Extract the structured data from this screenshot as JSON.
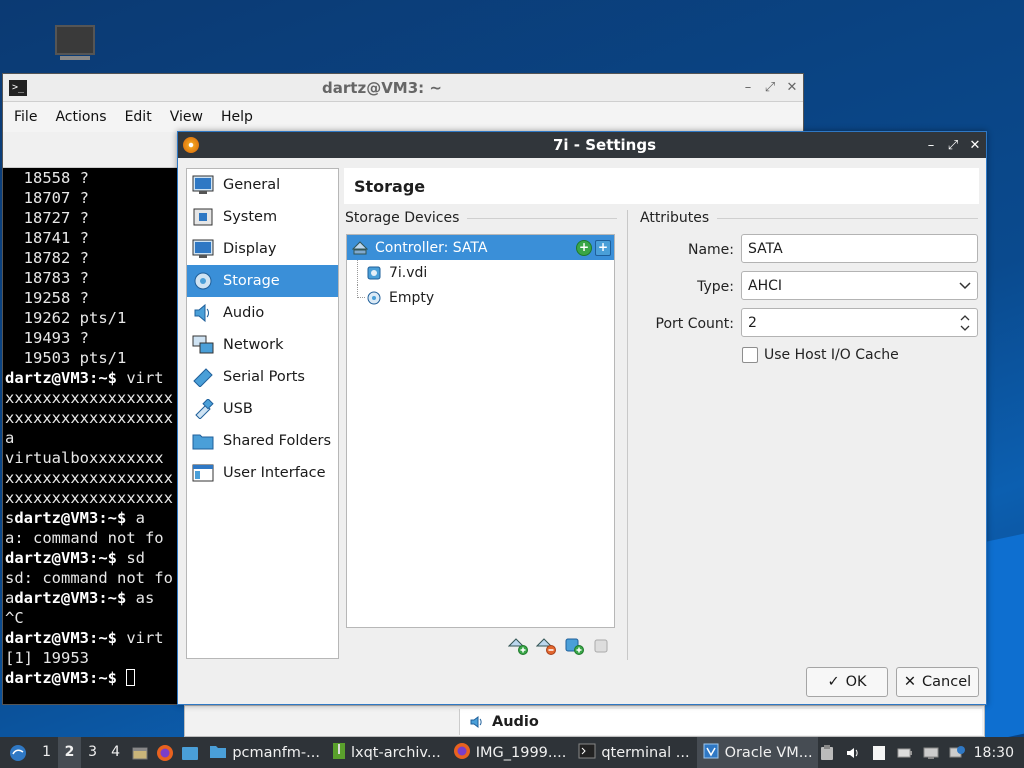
{
  "terminal": {
    "title": "dartz@VM3: ~",
    "menu": [
      "File",
      "Actions",
      "Edit",
      "View",
      "Help"
    ],
    "lines": [
      {
        "pre": "",
        "prompt": "",
        "text": "  18558 ?"
      },
      {
        "pre": "",
        "prompt": "",
        "text": "  18707 ?"
      },
      {
        "pre": "",
        "prompt": "",
        "text": "  18727 ?"
      },
      {
        "pre": "",
        "prompt": "",
        "text": "  18741 ?"
      },
      {
        "pre": "",
        "prompt": "",
        "text": "  18782 ?"
      },
      {
        "pre": "",
        "prompt": "",
        "text": "  18783 ?"
      },
      {
        "pre": "",
        "prompt": "",
        "text": "  19258 ?"
      },
      {
        "pre": "",
        "prompt": "",
        "text": "  19262 pts/1"
      },
      {
        "pre": "",
        "prompt": "",
        "text": "  19493 ?"
      },
      {
        "pre": "",
        "prompt": "",
        "text": "  19503 pts/1"
      },
      {
        "pre": "",
        "prompt": "dartz@VM3:~$",
        "text": " virt"
      },
      {
        "pre": "",
        "prompt": "",
        "text": "xxxxxxxxxxxxxxxxxx"
      },
      {
        "pre": "",
        "prompt": "",
        "text": "xxxxxxxxxxxxxxxxxx"
      },
      {
        "pre": "",
        "prompt": "",
        "text": "a"
      },
      {
        "pre": "",
        "prompt": "",
        "text": "virtualboxxxxxxxx"
      },
      {
        "pre": "",
        "prompt": "",
        "text": "xxxxxxxxxxxxxxxxxx"
      },
      {
        "pre": "",
        "prompt": "",
        "text": "xxxxxxxxxxxxxxxxxx"
      },
      {
        "pre": "s",
        "prompt": "dartz@VM3:~$",
        "text": " a"
      },
      {
        "pre": "",
        "prompt": "",
        "text": "a: command not fo"
      },
      {
        "pre": "",
        "prompt": "dartz@VM3:~$",
        "text": " sd"
      },
      {
        "pre": "",
        "prompt": "",
        "text": "sd: command not fo"
      },
      {
        "pre": "a",
        "prompt": "dartz@VM3:~$",
        "text": " as"
      },
      {
        "pre": "",
        "prompt": "",
        "text": "^C"
      },
      {
        "pre": "",
        "prompt": "dartz@VM3:~$",
        "text": " virt"
      },
      {
        "pre": "",
        "prompt": "",
        "text": "[1] 19953"
      },
      {
        "pre": "",
        "prompt": "dartz@VM3:~$",
        "text": " ",
        "cursor": true
      }
    ]
  },
  "dialog": {
    "title": "7i - Settings",
    "sidebar": [
      {
        "label": "General",
        "icon": "general-icon"
      },
      {
        "label": "System",
        "icon": "system-icon"
      },
      {
        "label": "Display",
        "icon": "display-icon"
      },
      {
        "label": "Storage",
        "icon": "storage-icon",
        "selected": true
      },
      {
        "label": "Audio",
        "icon": "audio-icon"
      },
      {
        "label": "Network",
        "icon": "network-icon"
      },
      {
        "label": "Serial Ports",
        "icon": "serial-ports-icon"
      },
      {
        "label": "USB",
        "icon": "usb-icon"
      },
      {
        "label": "Shared Folders",
        "icon": "shared-folders-icon"
      },
      {
        "label": "User Interface",
        "icon": "user-interface-icon"
      }
    ],
    "page_title": "Storage",
    "storage_devices_label": "Storage Devices",
    "attributes_label": "Attributes",
    "tree": {
      "controller": "Controller: SATA",
      "children": [
        "7i.vdi",
        "Empty"
      ]
    },
    "attributes": {
      "name_label": "Name:",
      "name_value": "SATA",
      "type_label": "Type:",
      "type_value": "AHCI",
      "port_count_label": "Port Count:",
      "port_count_value": "2",
      "host_io_cache_label": "Use Host I/O Cache",
      "host_io_cache_checked": false
    },
    "ok_label": "OK",
    "cancel_label": "Cancel"
  },
  "underlying_window": {
    "strip_label": "Audio"
  },
  "taskbar": {
    "workspaces": [
      "1",
      "2",
      "3",
      "4"
    ],
    "active_workspace": "2",
    "tasks": [
      {
        "label": "pcmanfm-...",
        "icon": "folder-icon"
      },
      {
        "label": "lxqt-archiv...",
        "icon": "archive-icon"
      },
      {
        "label": "IMG_1999....",
        "icon": "firefox-icon"
      },
      {
        "label": "qterminal ...",
        "icon": "terminal-icon"
      },
      {
        "label": "Oracle VM...",
        "icon": "virtualbox-icon",
        "active": true
      }
    ],
    "clock": "18:30"
  },
  "colors": {
    "selection": "#3a8fd8",
    "titlebar": "#31363b",
    "taskbar": "#2e3338"
  }
}
